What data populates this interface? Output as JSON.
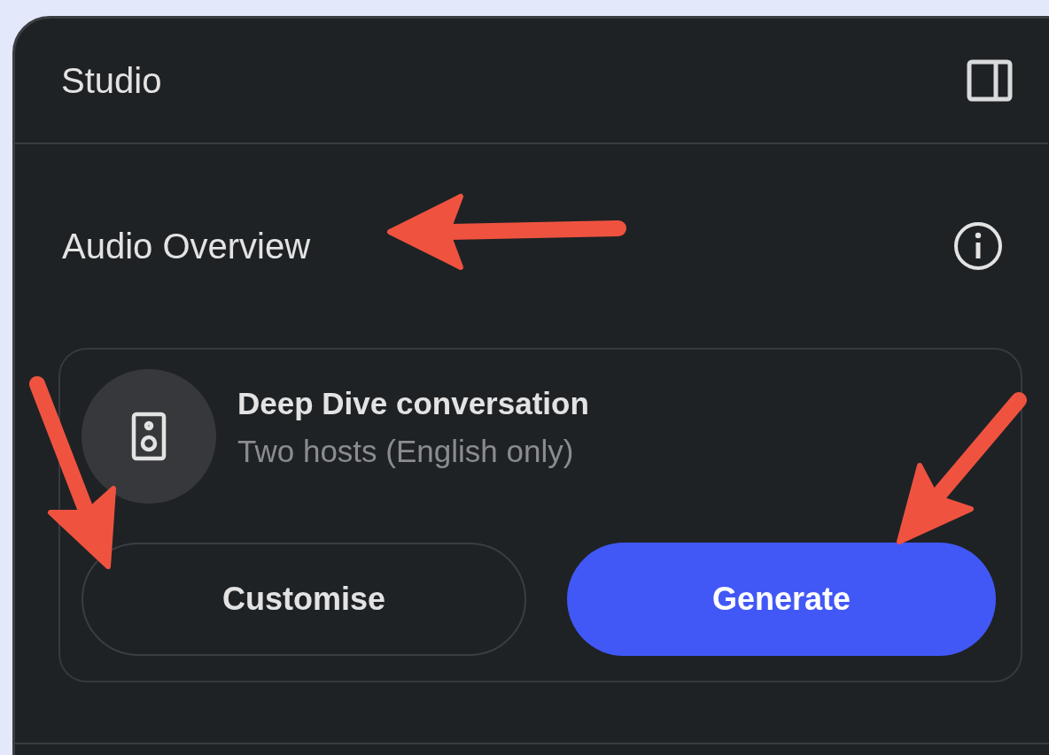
{
  "panel": {
    "title": "Studio"
  },
  "section": {
    "title": "Audio Overview"
  },
  "card": {
    "title": "Deep Dive conversation",
    "subtitle": "Two hosts (English only)",
    "buttons": [
      {
        "label": "Customise",
        "kind": "outline"
      },
      {
        "label": "Generate",
        "kind": "filled"
      }
    ]
  }
}
